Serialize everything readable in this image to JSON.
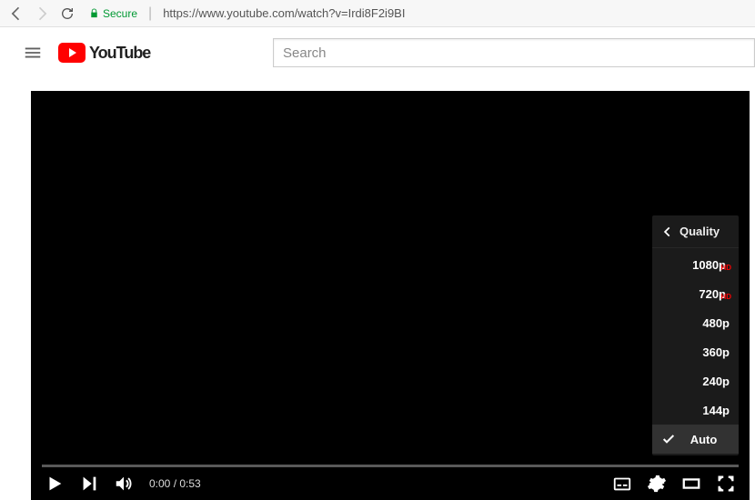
{
  "browser": {
    "secure_label": "Secure",
    "url": "https://www.youtube.com/watch?v=Irdi8F2i9BI"
  },
  "header": {
    "logo_text": "YouTube",
    "search_placeholder": "Search"
  },
  "player": {
    "time_current": "0:00",
    "time_sep": " / ",
    "time_duration": "0:53"
  },
  "quality_menu": {
    "title": "Quality",
    "items": [
      {
        "label": "1080p",
        "hd": true,
        "selected": false
      },
      {
        "label": "720p",
        "hd": true,
        "selected": false
      },
      {
        "label": "480p",
        "hd": false,
        "selected": false
      },
      {
        "label": "360p",
        "hd": false,
        "selected": false
      },
      {
        "label": "240p",
        "hd": false,
        "selected": false
      },
      {
        "label": "144p",
        "hd": false,
        "selected": false
      },
      {
        "label": "Auto",
        "hd": false,
        "selected": true
      }
    ],
    "hd_badge": "HD"
  }
}
